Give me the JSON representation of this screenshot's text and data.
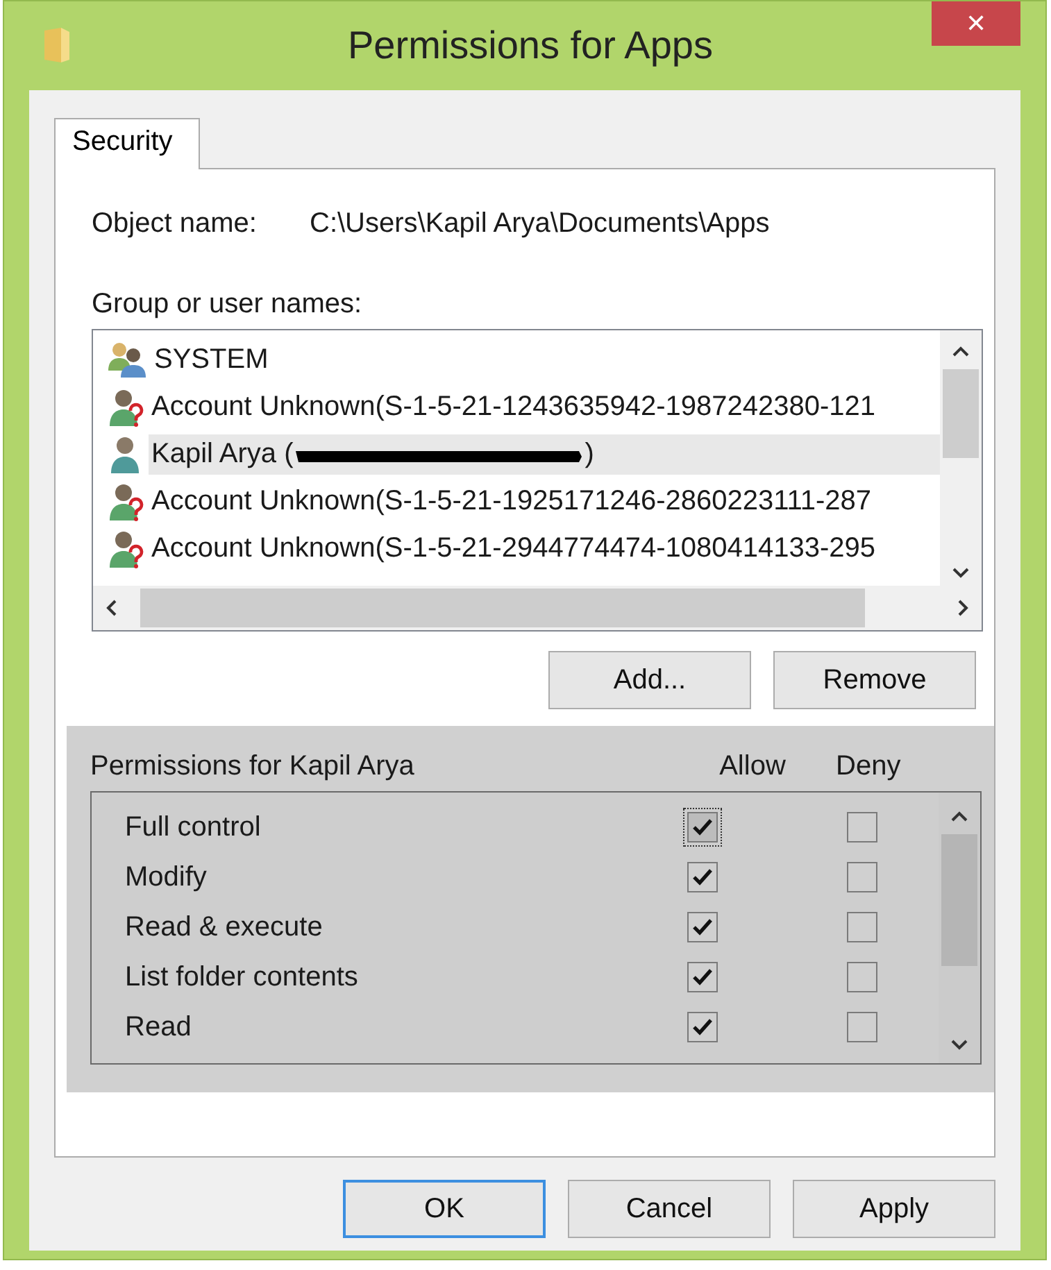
{
  "window": {
    "title": "Permissions for Apps",
    "close_button": "✕"
  },
  "tabs": [
    {
      "label": "Security",
      "selected": true
    }
  ],
  "object_name": {
    "label": "Object name:",
    "value": "C:\\Users\\Kapil Arya\\Documents\\Apps"
  },
  "users": {
    "label": "Group or user names:",
    "items": [
      {
        "kind": "group",
        "label": "SYSTEM",
        "selected": false
      },
      {
        "kind": "unknown",
        "label": "Account Unknown(S-1-5-21-1243635942-1987242380-121",
        "selected": false
      },
      {
        "kind": "user",
        "label": "Kapil Arya (",
        "label_end": ")",
        "redacted": true,
        "selected": true
      },
      {
        "kind": "unknown",
        "label": "Account Unknown(S-1-5-21-1925171246-2860223111-287",
        "selected": false
      },
      {
        "kind": "unknown",
        "label": "Account Unknown(S-1-5-21-2944774474-1080414133-295",
        "selected": false
      }
    ]
  },
  "user_buttons": [
    "Add...",
    "Remove"
  ],
  "permissions": {
    "title": "Permissions for Kapil Arya",
    "columns": [
      "Allow",
      "Deny"
    ],
    "rows": [
      {
        "name": "Full control",
        "allow": true,
        "deny": false,
        "focused": true
      },
      {
        "name": "Modify",
        "allow": true,
        "deny": false,
        "focused": false
      },
      {
        "name": "Read & execute",
        "allow": true,
        "deny": false,
        "focused": false
      },
      {
        "name": "List folder contents",
        "allow": true,
        "deny": false,
        "focused": false
      },
      {
        "name": "Read",
        "allow": true,
        "deny": false,
        "focused": false
      }
    ]
  },
  "buttons": [
    {
      "label": "OK",
      "default": true
    },
    {
      "label": "Cancel",
      "default": false
    },
    {
      "label": "Apply",
      "default": false
    }
  ]
}
